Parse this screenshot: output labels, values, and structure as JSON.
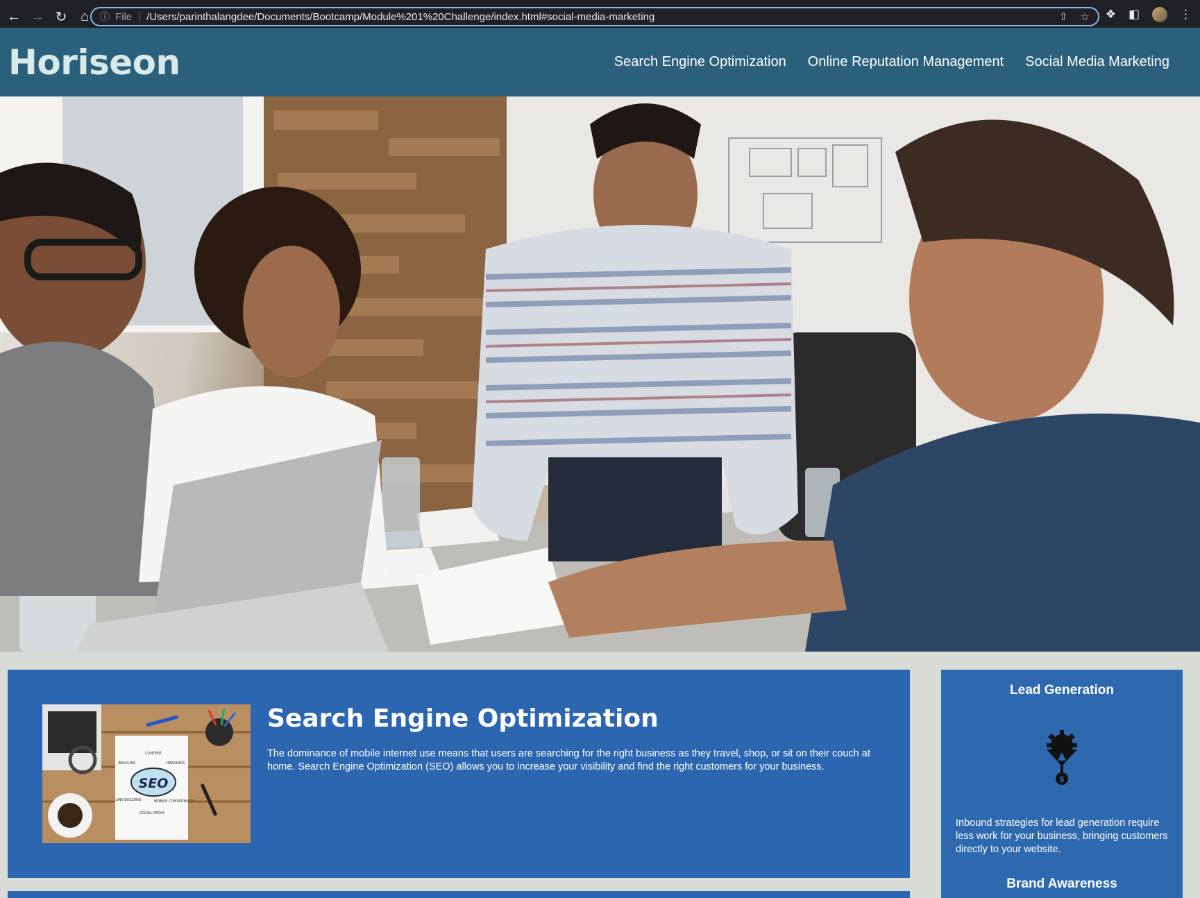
{
  "browser": {
    "scheme_label": "File",
    "url": "/Users/parinthalangdee/Documents/Bootcamp/Module%201%20Challenge/index.html#social-media-marketing",
    "icons": [
      "back-icon",
      "forward-icon",
      "reload-icon",
      "home-icon",
      "info-icon",
      "share-icon",
      "star-icon",
      "extensions-icon",
      "sidepanel-icon",
      "profile-avatar",
      "menu-icon"
    ]
  },
  "header": {
    "logo": "Horiseon",
    "nav": [
      {
        "label": "Search Engine Optimization"
      },
      {
        "label": "Online Reputation Management"
      },
      {
        "label": "Social Media Marketing"
      }
    ]
  },
  "hero": {
    "image": "team-meeting-photo"
  },
  "main": {
    "seo": {
      "title": "Search Engine Optimization",
      "text": "The dominance of mobile internet use means that users are searching for the right business as they travel, shop, or sit on their couch at home. Search Engine Optimization (SEO) allows you to increase your visibility and find the right customers for your business.",
      "image_words": [
        "CONTENT",
        "HEADINGS",
        "BACKLINK",
        "SEO",
        "LINK BUILDING",
        "MOBILE COMPATIBILITY",
        "SOCIAL MEDIA"
      ]
    }
  },
  "sidebar": {
    "lead": {
      "title": "Lead Generation",
      "text": "Inbound strategies for lead generation require less work for your business, bringing customers directly to your website."
    },
    "brand": {
      "title": "Brand Awareness"
    }
  },
  "colors": {
    "header_bg": "#2a607c",
    "logo": "#d9e9e8",
    "card_bg": "#2c66b0",
    "page_bg": "#d9dcd6"
  }
}
